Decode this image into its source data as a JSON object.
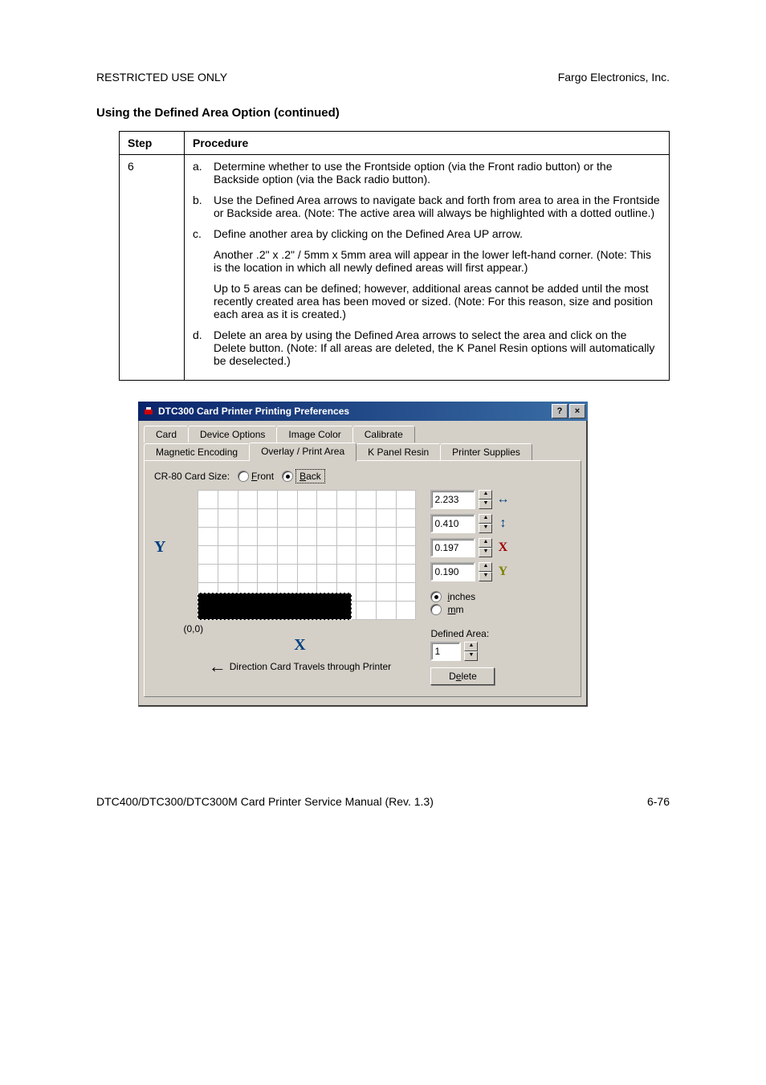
{
  "header": {
    "left": "RESTRICTED USE ONLY",
    "right": "Fargo Electronics, Inc."
  },
  "section_title": "Using the Defined Area Option (continued)",
  "table": {
    "headers": {
      "step": "Step",
      "procedure": "Procedure"
    },
    "step_number": "6",
    "items": {
      "a": {
        "label": "a.",
        "text": "Determine whether to use the Frontside option (via the Front radio button) or the Backside option (via the Back radio button)."
      },
      "b": {
        "label": "b.",
        "text": "Use the Defined Area arrows to navigate back and forth from area to area in the Frontside or Backside area. (Note:  The active area will always be highlighted with a dotted outline.)"
      },
      "c": {
        "label": "c.",
        "text": "Define another area by clicking on the Defined Area UP arrow."
      },
      "c_sub1": "Another .2\" x .2\" / 5mm x 5mm area will appear in the lower left-hand corner. (Note: This is the location in which all newly defined areas will first appear.)",
      "c_sub2": "Up to 5 areas can be defined; however, additional areas cannot be added until the most recently created area has been moved or sized. (Note: For this reason, size and position each area as it is created.)",
      "d": {
        "label": "d.",
        "text": "Delete an area by using the Defined Area arrows to select the area and click on the Delete button. (Note: If all areas are deleted, the K Panel Resin options will automatically be deselected.)"
      }
    }
  },
  "dialog": {
    "title": "DTC300 Card Printer Printing Preferences",
    "help_btn": "?",
    "close_btn": "×",
    "tabs": {
      "row1": {
        "card": "Card",
        "device_options": "Device Options",
        "image_color": "Image Color",
        "calibrate": "Calibrate"
      },
      "row2": {
        "magnetic": "Magnetic Encoding",
        "overlay": "Overlay / Print Area",
        "kpanel": "K Panel Resin",
        "supplies": "Printer Supplies"
      }
    },
    "cardsize_label": "CR-80 Card Size:",
    "front_label": "Front",
    "back_label": "Back",
    "origin": "(0,0)",
    "x_axis": "X",
    "y_axis": "Y",
    "direction_text": "Direction Card Travels through Printer",
    "values": {
      "w": "2.233",
      "h": "0.410",
      "x": "0.197",
      "y": "0.190"
    },
    "dim_icons": {
      "w": "↔",
      "h": "↕",
      "x": "X",
      "y": "Y"
    },
    "units": {
      "inches": "inches",
      "mm": "mm"
    },
    "defined_area_label": "Defined Area:",
    "defined_area_value": "1",
    "delete_btn": "Delete"
  },
  "footer": {
    "left": "DTC400/DTC300/DTC300M Card Printer Service Manual (Rev. 1.3)",
    "right": "6-76"
  }
}
